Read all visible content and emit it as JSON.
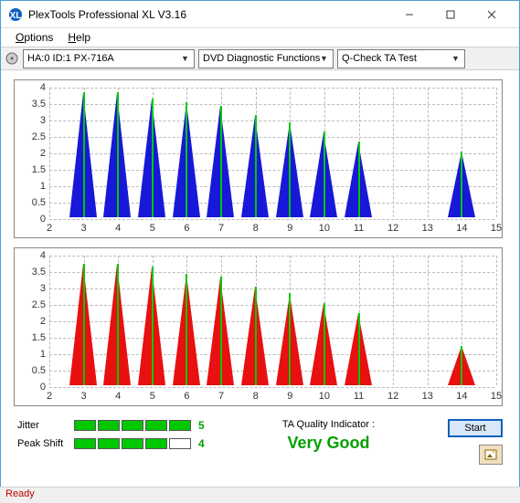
{
  "window": {
    "title": "PlexTools Professional XL V3.16"
  },
  "menu": {
    "options": "Options",
    "help": "Help"
  },
  "toolbar": {
    "drive": "HA:0 ID:1  PX-716A",
    "function": "DVD Diagnostic Functions",
    "test": "Q-Check TA Test"
  },
  "chart_data": [
    {
      "type": "bar",
      "color": "#1818d8",
      "xrange": [
        2,
        15
      ],
      "yrange": [
        0,
        4
      ],
      "yticks": [
        0,
        0.5,
        1,
        1.5,
        2,
        2.5,
        3,
        3.5,
        4
      ],
      "xticks": [
        2,
        3,
        4,
        5,
        6,
        7,
        8,
        9,
        10,
        11,
        12,
        13,
        14,
        15
      ],
      "peaks": [
        {
          "x": 3,
          "h": 3.8
        },
        {
          "x": 4,
          "h": 3.8
        },
        {
          "x": 5,
          "h": 3.6
        },
        {
          "x": 6,
          "h": 3.5
        },
        {
          "x": 7,
          "h": 3.4
        },
        {
          "x": 8,
          "h": 3.1
        },
        {
          "x": 9,
          "h": 2.9
        },
        {
          "x": 10,
          "h": 2.6
        },
        {
          "x": 11,
          "h": 2.3
        },
        {
          "x": 14,
          "h": 2.0
        }
      ]
    },
    {
      "type": "bar",
      "color": "#e81010",
      "xrange": [
        2,
        15
      ],
      "yrange": [
        0,
        4
      ],
      "yticks": [
        0,
        0.5,
        1,
        1.5,
        2,
        2.5,
        3,
        3.5,
        4
      ],
      "xticks": [
        2,
        3,
        4,
        5,
        6,
        7,
        8,
        9,
        10,
        11,
        12,
        13,
        14,
        15
      ],
      "peaks": [
        {
          "x": 3,
          "h": 3.7
        },
        {
          "x": 4,
          "h": 3.7
        },
        {
          "x": 5,
          "h": 3.6
        },
        {
          "x": 6,
          "h": 3.4
        },
        {
          "x": 7,
          "h": 3.3
        },
        {
          "x": 8,
          "h": 3.0
        },
        {
          "x": 9,
          "h": 2.8
        },
        {
          "x": 10,
          "h": 2.5
        },
        {
          "x": 11,
          "h": 2.2
        },
        {
          "x": 14,
          "h": 1.2
        }
      ]
    }
  ],
  "results": {
    "jitter_label": "Jitter",
    "jitter_segments": 5,
    "jitter_value": "5",
    "peakshift_label": "Peak Shift",
    "peakshift_segments": 4,
    "peakshift_value": "4",
    "qi_label": "TA Quality Indicator :",
    "qi_value": "Very Good",
    "start_label": "Start"
  },
  "statusbar": {
    "text": "Ready"
  }
}
